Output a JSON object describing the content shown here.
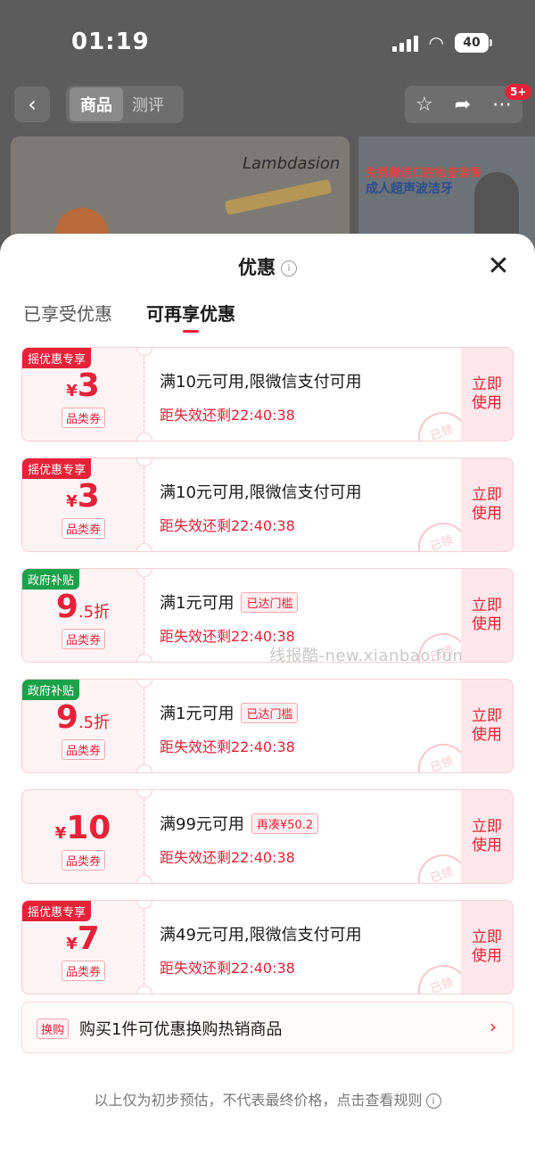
{
  "status_bar": {
    "time": "01:19",
    "battery": "40"
  },
  "product_nav": {
    "back": "‹",
    "segments": [
      "商品",
      "测评"
    ],
    "badge": "5+"
  },
  "background": {
    "hero1_brand": "Lambdasion",
    "hero2_line1": "免费赠送口腔检查套餐",
    "hero2_line2": "成人超声波洁牙"
  },
  "sheet": {
    "title": "优惠",
    "close": "✕",
    "tabs": [
      "已享受优惠",
      "可再享优惠"
    ],
    "active_tab": 1
  },
  "coupons": [
    {
      "tag": "摇优惠专享",
      "tag_color": "red",
      "currency": "¥",
      "amount": "3",
      "suffix": "",
      "type": "品类券",
      "condition": "满10元可用,限微信支付可用",
      "chip": "",
      "expire": "距失效还剩22:40:38",
      "stamp": "已领",
      "action": "立即使用"
    },
    {
      "tag": "摇优惠专享",
      "tag_color": "red",
      "currency": "¥",
      "amount": "3",
      "suffix": "",
      "type": "品类券",
      "condition": "满10元可用,限微信支付可用",
      "chip": "",
      "expire": "距失效还剩22:40:38",
      "stamp": "已领",
      "action": "立即使用"
    },
    {
      "tag": "政府补贴",
      "tag_color": "green",
      "currency": "",
      "amount": "9",
      "suffix": ".5折",
      "type": "品类券",
      "condition": "满1元可用",
      "chip": "已达门槛",
      "expire": "距失效还剩22:40:38",
      "stamp": "已领",
      "action": "立即使用"
    },
    {
      "tag": "政府补贴",
      "tag_color": "green",
      "currency": "",
      "amount": "9",
      "suffix": ".5折",
      "type": "品类券",
      "condition": "满1元可用",
      "chip": "已达门槛",
      "expire": "距失效还剩22:40:38",
      "stamp": "已领",
      "action": "立即使用"
    },
    {
      "tag": "",
      "tag_color": "red",
      "currency": "¥",
      "amount": "10",
      "suffix": "",
      "type": "品类券",
      "condition": "满99元可用",
      "chip": "再凑¥50.2",
      "expire": "距失效还剩22:40:38",
      "stamp": "已领",
      "action": "立即使用"
    },
    {
      "tag": "摇优惠专享",
      "tag_color": "red",
      "currency": "¥",
      "amount": "7",
      "suffix": "",
      "type": "品类券",
      "condition": "满49元可用,限微信支付可用",
      "chip": "",
      "expire": "距失效还剩22:40:38",
      "stamp": "已领",
      "action": "立即使用"
    }
  ],
  "watermark": "线报酷-new.xianbao.fun",
  "exchange": {
    "tag": "换购",
    "text": "购买1件可优惠换购热销商品",
    "arrow": "›"
  },
  "footer": {
    "text": "以上仅为初步预估，不代表最终价格，点击查看规则",
    "info": "i"
  },
  "colors": {
    "accent": "#e52238",
    "green": "#1aa24a"
  }
}
